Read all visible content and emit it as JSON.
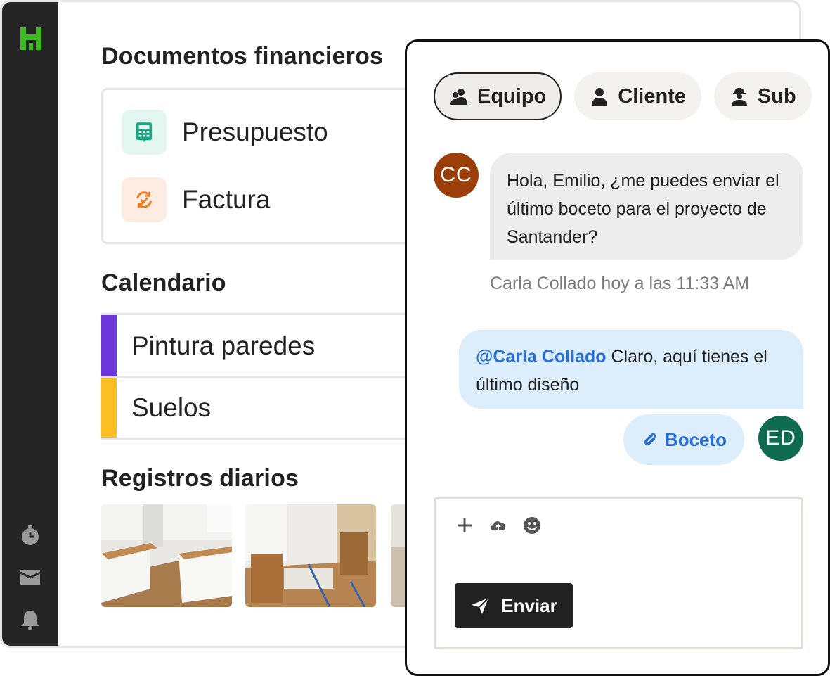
{
  "colors": {
    "sidebar": "#252525",
    "logo_green": "#3dba1f",
    "calendar_purple": "#6b35d9",
    "calendar_yellow": "#fbbf24",
    "avatar_cc": "#9a3f0a",
    "avatar_ed": "#0e6b4f",
    "link_blue": "#2b6fd6"
  },
  "sidebar": {
    "icons": [
      "home-logo-icon",
      "stopwatch-icon",
      "inbox-icon",
      "bell-icon"
    ]
  },
  "main": {
    "financial": {
      "title": "Documentos financieros",
      "items": [
        {
          "label": "Presupuesto",
          "icon": "calculator-icon"
        },
        {
          "label": "Factura",
          "icon": "refresh-check-icon"
        }
      ]
    },
    "calendar": {
      "title": "Calendario",
      "items": [
        {
          "label": "Pintura paredes",
          "color": "#6b35d9"
        },
        {
          "label": "Suelos",
          "color": "#fbbf24"
        }
      ]
    },
    "daily_logs": {
      "title": "Registros diarios",
      "photos": [
        "kitchen-cabinets-photo",
        "flooring-materials-photo",
        "partial-room-photo"
      ]
    }
  },
  "chat": {
    "tabs": [
      {
        "label": "Equipo",
        "icon": "team-icon",
        "active": true
      },
      {
        "label": "Cliente",
        "icon": "person-icon",
        "active": false
      },
      {
        "label": "Sub",
        "icon": "worker-icon",
        "active": false
      }
    ],
    "incoming": {
      "avatar": "CC",
      "text": "Hola, Emilio, ¿me puedes enviar el último boceto para el proyecto de Santander?",
      "meta": "Carla Collado hoy a las 11:33 AM"
    },
    "outgoing": {
      "mention": "@Carla Collado",
      "text": " Claro, aquí tienes el último diseño",
      "avatar": "ED",
      "attachment": "Boceto"
    },
    "composer": {
      "tools": [
        "plus-icon",
        "upload-cloud-icon",
        "emoji-icon"
      ],
      "send_label": "Enviar"
    }
  }
}
